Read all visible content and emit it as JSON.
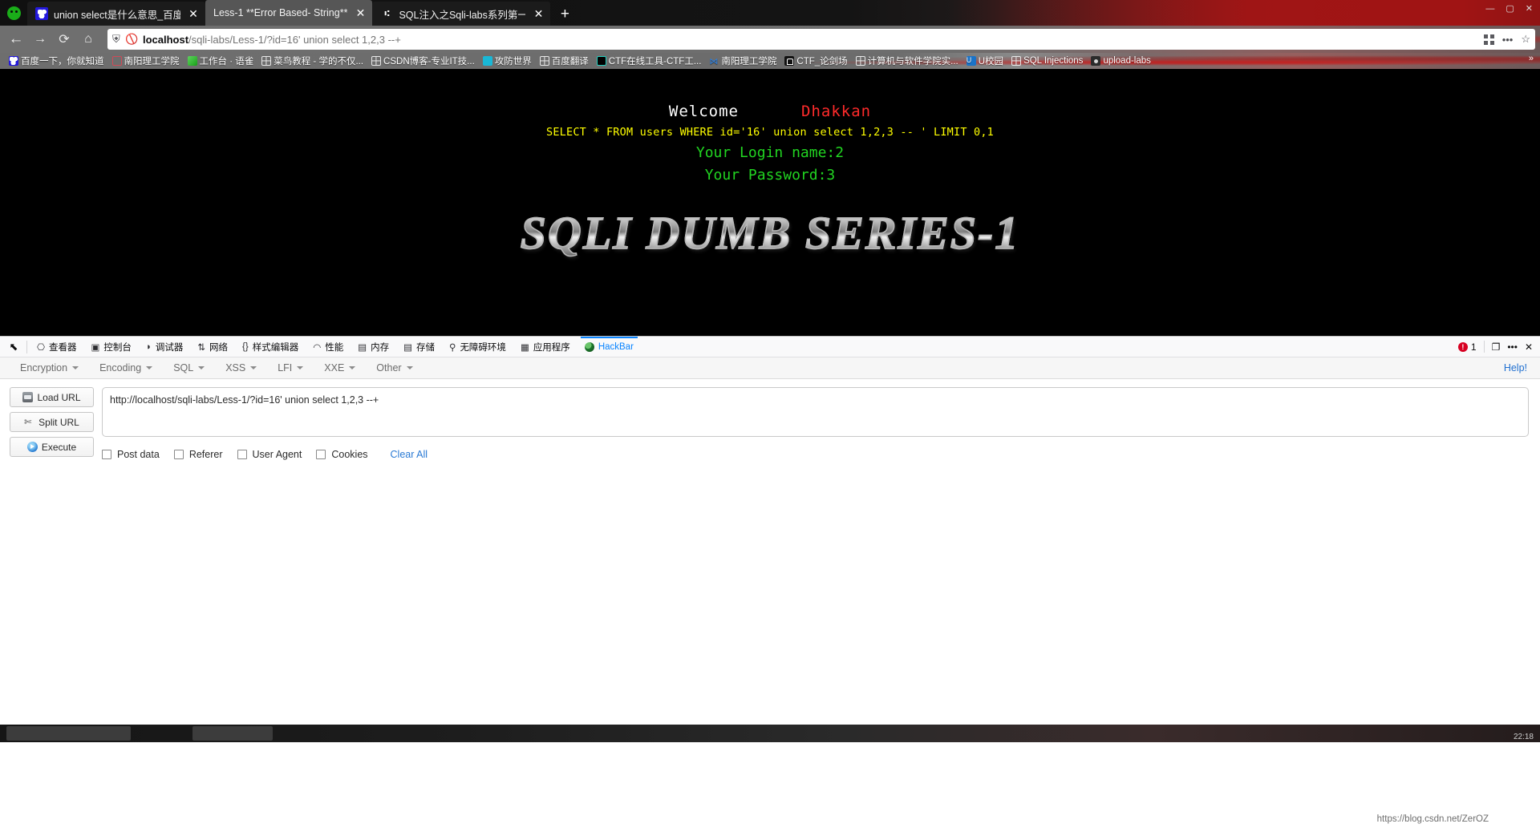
{
  "browser": {
    "tabs": [
      {
        "title": "union select是什么意思_百度搜",
        "favicon": "baidu-icon",
        "active": false,
        "close": "✕"
      },
      {
        "title": "Less-1 **Error Based- String**",
        "favicon": "blank-page-icon",
        "active": true,
        "close": "✕"
      },
      {
        "title": "SQL注入之Sqli-labs系列第一关",
        "favicon": "doc-icon",
        "active": false,
        "close": "✕"
      }
    ],
    "new_tab_label": "+",
    "window_controls": {
      "minimize": "—",
      "maximize": "▢",
      "close": "✕"
    },
    "nav": {
      "back": "←",
      "forward": "→",
      "reload": "⟳",
      "home": "⌂",
      "shield_icon": "shield-icon",
      "noscript_icon": "noscript-icon",
      "url_host": "localhost",
      "url_path": "/sqli-labs/Less-1/?id=16' union select 1,2,3 --+",
      "qr_icon": "qr-icon",
      "more_icon": "•••",
      "bookmark_icon": "☆"
    },
    "bookmarks": [
      {
        "label": "百度一下，你就知道",
        "icon": "baidu-icon"
      },
      {
        "label": "南阳理工学院",
        "icon": "circle-red-icon"
      },
      {
        "label": "工作台 · 语雀",
        "icon": "leaf-icon"
      },
      {
        "label": "菜鸟教程 - 学的不仅...",
        "icon": "globe-icon"
      },
      {
        "label": "CSDN博客-专业IT技...",
        "icon": "globe-icon"
      },
      {
        "label": "攻防世界",
        "icon": "cyan-icon"
      },
      {
        "label": "百度翻译",
        "icon": "globe-icon"
      },
      {
        "label": "CTF在线工具-CTF工...",
        "icon": "moon-icon"
      },
      {
        "label": "南阳理工学院",
        "icon": "blue-x-icon"
      },
      {
        "label": "CTF_论剑场",
        "icon": "ctf-icon"
      },
      {
        "label": "计算机与软件学院实...",
        "icon": "globe-icon"
      },
      {
        "label": "U校园",
        "icon": "u-icon"
      },
      {
        "label": "SQL Injections",
        "icon": "globe-icon"
      },
      {
        "label": "upload-labs",
        "icon": "camera-icon"
      }
    ],
    "bookmarks_overflow": "»"
  },
  "page": {
    "welcome": "Welcome",
    "dhakkan": "Dhakkan",
    "sql_query": "SELECT * FROM users WHERE id='16' union select 1,2,3 -- ' LIMIT 0,1",
    "login_name": "Your Login name:2",
    "password": "Your Password:3",
    "banner": "SQLI DUMB SERIES-1"
  },
  "devtools": {
    "picker_icon": "element-picker-icon",
    "tabs": [
      {
        "label": "查看器",
        "icon": "inspector-icon",
        "active": false
      },
      {
        "label": "控制台",
        "icon": "console-icon",
        "active": false
      },
      {
        "label": "调试器",
        "icon": "debugger-icon",
        "active": false
      },
      {
        "label": "网络",
        "icon": "network-icon",
        "active": false
      },
      {
        "label": "样式编辑器",
        "icon": "style-editor-icon",
        "active": false
      },
      {
        "label": "性能",
        "icon": "performance-icon",
        "active": false
      },
      {
        "label": "内存",
        "icon": "memory-icon",
        "active": false
      },
      {
        "label": "存储",
        "icon": "storage-icon",
        "active": false
      },
      {
        "label": "无障碍环境",
        "icon": "accessibility-icon",
        "active": false
      },
      {
        "label": "应用程序",
        "icon": "application-icon",
        "active": false
      },
      {
        "label": "HackBar",
        "icon": "hackbar-icon",
        "active": true
      }
    ],
    "error_count": "1",
    "responsive_icon": "responsive-design-icon",
    "more_icon": "•••",
    "close_icon": "✕"
  },
  "hackbar": {
    "menus": [
      {
        "label": "Encryption"
      },
      {
        "label": "Encoding"
      },
      {
        "label": "SQL"
      },
      {
        "label": "XSS"
      },
      {
        "label": "LFI"
      },
      {
        "label": "XXE"
      },
      {
        "label": "Other"
      }
    ],
    "help_label": "Help!",
    "buttons": [
      {
        "label": "Load URL",
        "icon": "load-url-icon"
      },
      {
        "label": "Split URL",
        "icon": "split-url-icon"
      },
      {
        "label": "Execute",
        "icon": "execute-icon"
      }
    ],
    "url_value": "http://localhost/sqli-labs/Less-1/?id=16' union select 1,2,3 --+",
    "url_placeholder": "",
    "checkboxes": [
      {
        "label": "Post data",
        "checked": false
      },
      {
        "label": "Referer",
        "checked": false
      },
      {
        "label": "User Agent",
        "checked": false
      },
      {
        "label": "Cookies",
        "checked": false
      }
    ],
    "clear_all": "Clear All"
  },
  "taskbar": {
    "watermark": "https://blog.csdn.net/ZerOZ",
    "clock": "22:18"
  },
  "colors": {
    "accent": "#0a84ff",
    "error": "#d70022",
    "sql_yellow": "#ffff00",
    "result_green": "#21d421",
    "dhakkan_red": "#ff2b2b",
    "link_blue": "#2a7ad4"
  }
}
